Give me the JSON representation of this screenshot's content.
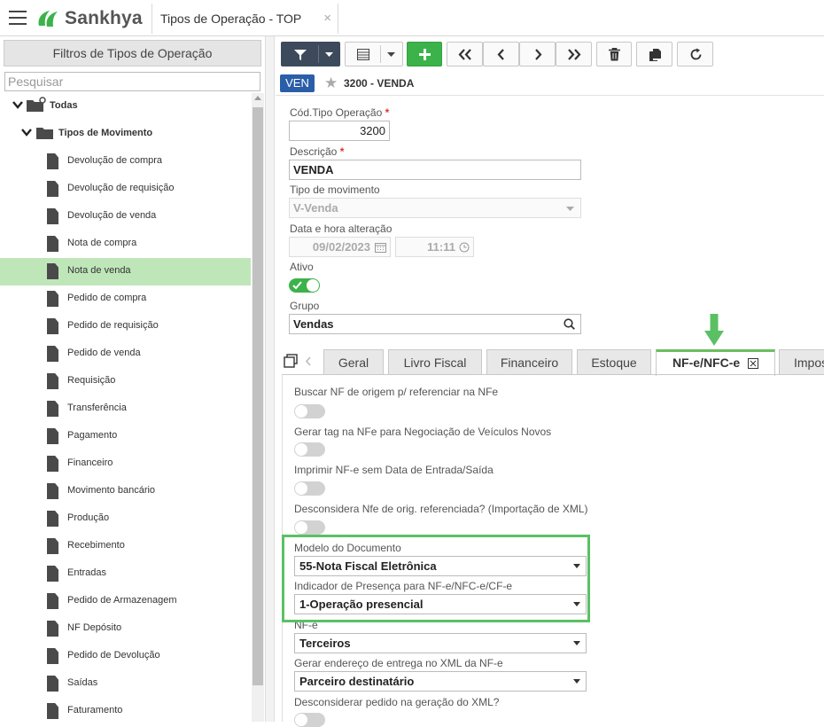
{
  "app": {
    "brand": "Sankhya",
    "open_tab": "Tipos de Operação - TOP",
    "close_glyph": "×"
  },
  "left_panel": {
    "header": "Filtros de Tipos de Operação",
    "search_placeholder": "Pesquisar",
    "root": "Todas",
    "group": "Tipos de Movimento",
    "items": [
      "Devolução de compra",
      "Devolução de requisição",
      "Devolução de venda",
      "Nota de compra",
      "Nota de venda",
      "Pedido de compra",
      "Pedido de requisição",
      "Pedido de venda",
      "Requisição",
      "Transferência",
      "Pagamento",
      "Financeiro",
      "Movimento bancário",
      "Produção",
      "Recebimento",
      "Entradas",
      "Pedido de Armazenagem",
      "NF Depósito",
      "Pedido de Devolução",
      "Saídas",
      "Faturamento"
    ],
    "selected": "Nota de venda"
  },
  "toolbar": {
    "buttons": [
      "filter-icon",
      "list-icon",
      "add-icon",
      "first-icon",
      "previous-icon",
      "next-icon",
      "last-icon",
      "trash-icon",
      "copy-icon",
      "refresh-icon"
    ],
    "accent": "#3cb34a",
    "filter_bg": "#3d4a5c"
  },
  "record": {
    "badge": "VEN",
    "title": "3200 - VENDA"
  },
  "form": {
    "cod_label": "Cód.Tipo Operação",
    "cod_value": "3200",
    "descricao_label": "Descrição",
    "descricao_value": "VENDA",
    "tipo_mov_label": "Tipo de movimento",
    "tipo_mov_value": "V-Venda",
    "data_label": "Data e hora alteração",
    "data_value": "09/02/2023",
    "hora_value": "11:11",
    "ativo_label": "Ativo",
    "ativo_on": true,
    "grupo_label": "Grupo",
    "grupo_value": "Vendas",
    "required_mark": "*"
  },
  "tabs": [
    "Geral",
    "Livro Fiscal",
    "Financeiro",
    "Estoque",
    "NF-e/NFC-e",
    "Impos"
  ],
  "active_tab": "NF-e/NFC-e",
  "nfe": {
    "buscar_label": "Buscar NF de origem p/ referenciar na NFe",
    "gerar_tag_label": "Gerar tag na NFe para Negociação de Veículos Novos",
    "imprimir_label": "Imprimir NF-e sem Data de Entrada/Saída",
    "desconsidera_label": "Desconsidera Nfe de orig. referenciada? (Importação de XML)",
    "modelo_label": "Modelo do Documento",
    "modelo_value": "55-Nota Fiscal Eletrônica",
    "indicador_label": "Indicador de Presença para NF-e/NFC-e/CF-e",
    "indicador_value": "1-Operação presencial",
    "nfe_label_partial": "NF-e",
    "terceiros_value": "Terceiros",
    "gerar_endereco_label": "Gerar endereço de entrega no XML da NF-e",
    "parceiro_value": "Parceiro destinatário",
    "desconsiderar_pedido_label": "Desconsiderar pedido na geração do XML?"
  }
}
